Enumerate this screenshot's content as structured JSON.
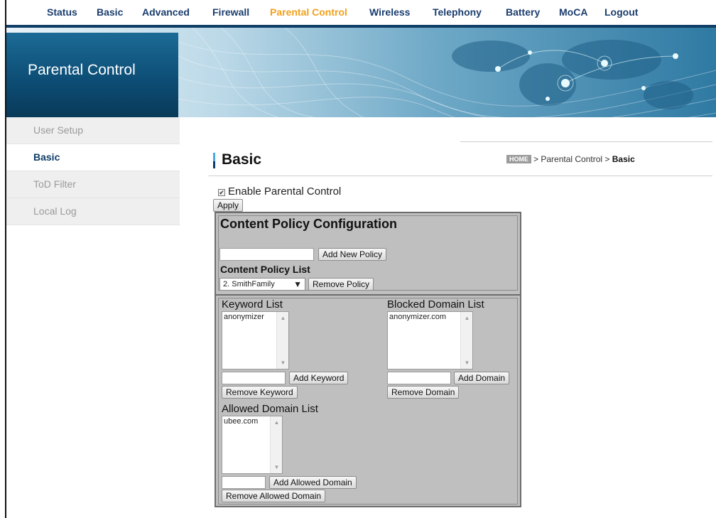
{
  "nav": {
    "items": [
      "Status",
      "Basic",
      "Advanced",
      "Firewall",
      "Parental Control",
      "Wireless",
      "Telephony",
      "Battery",
      "MoCA",
      "Logout"
    ],
    "active_index": 4
  },
  "banner": {
    "title": "Parental Control"
  },
  "sidemenu": {
    "items": [
      "User Setup",
      "Basic",
      "ToD Filter",
      "Local Log"
    ],
    "active_index": 1
  },
  "page": {
    "title": "Basic",
    "breadcrumb": {
      "home": "HOME",
      "path": "> Parental Control >",
      "current": "Basic"
    }
  },
  "enable": {
    "label": "Enable Parental Control",
    "checked": true
  },
  "apply_label": "Apply",
  "content_policy": {
    "title": "Content Policy Configuration",
    "new_policy_value": "",
    "add_policy_label": "Add New Policy",
    "list_title": "Content Policy List",
    "selected_policy": "2. SmithFamily",
    "remove_policy_label": "Remove Policy"
  },
  "keyword": {
    "title": "Keyword List",
    "items": [
      "anonymizer"
    ],
    "input_value": "",
    "add_label": "Add Keyword",
    "remove_label": "Remove Keyword"
  },
  "blocked": {
    "title": "Blocked Domain List",
    "items": [
      "anonymizer.com"
    ],
    "input_value": "",
    "add_label": "Add Domain",
    "remove_label": "Remove Domain"
  },
  "allowed": {
    "title": "Allowed Domain List",
    "items": [
      "ubee.com"
    ],
    "input_value": "",
    "add_label": "Add Allowed Domain",
    "remove_label": "Remove Allowed Domain"
  },
  "colors": {
    "nav_text": "#1a3d6e",
    "nav_active": "#f2a11c",
    "banner_dark": "#0d4e76",
    "panel_gray": "#bfbfbf"
  }
}
